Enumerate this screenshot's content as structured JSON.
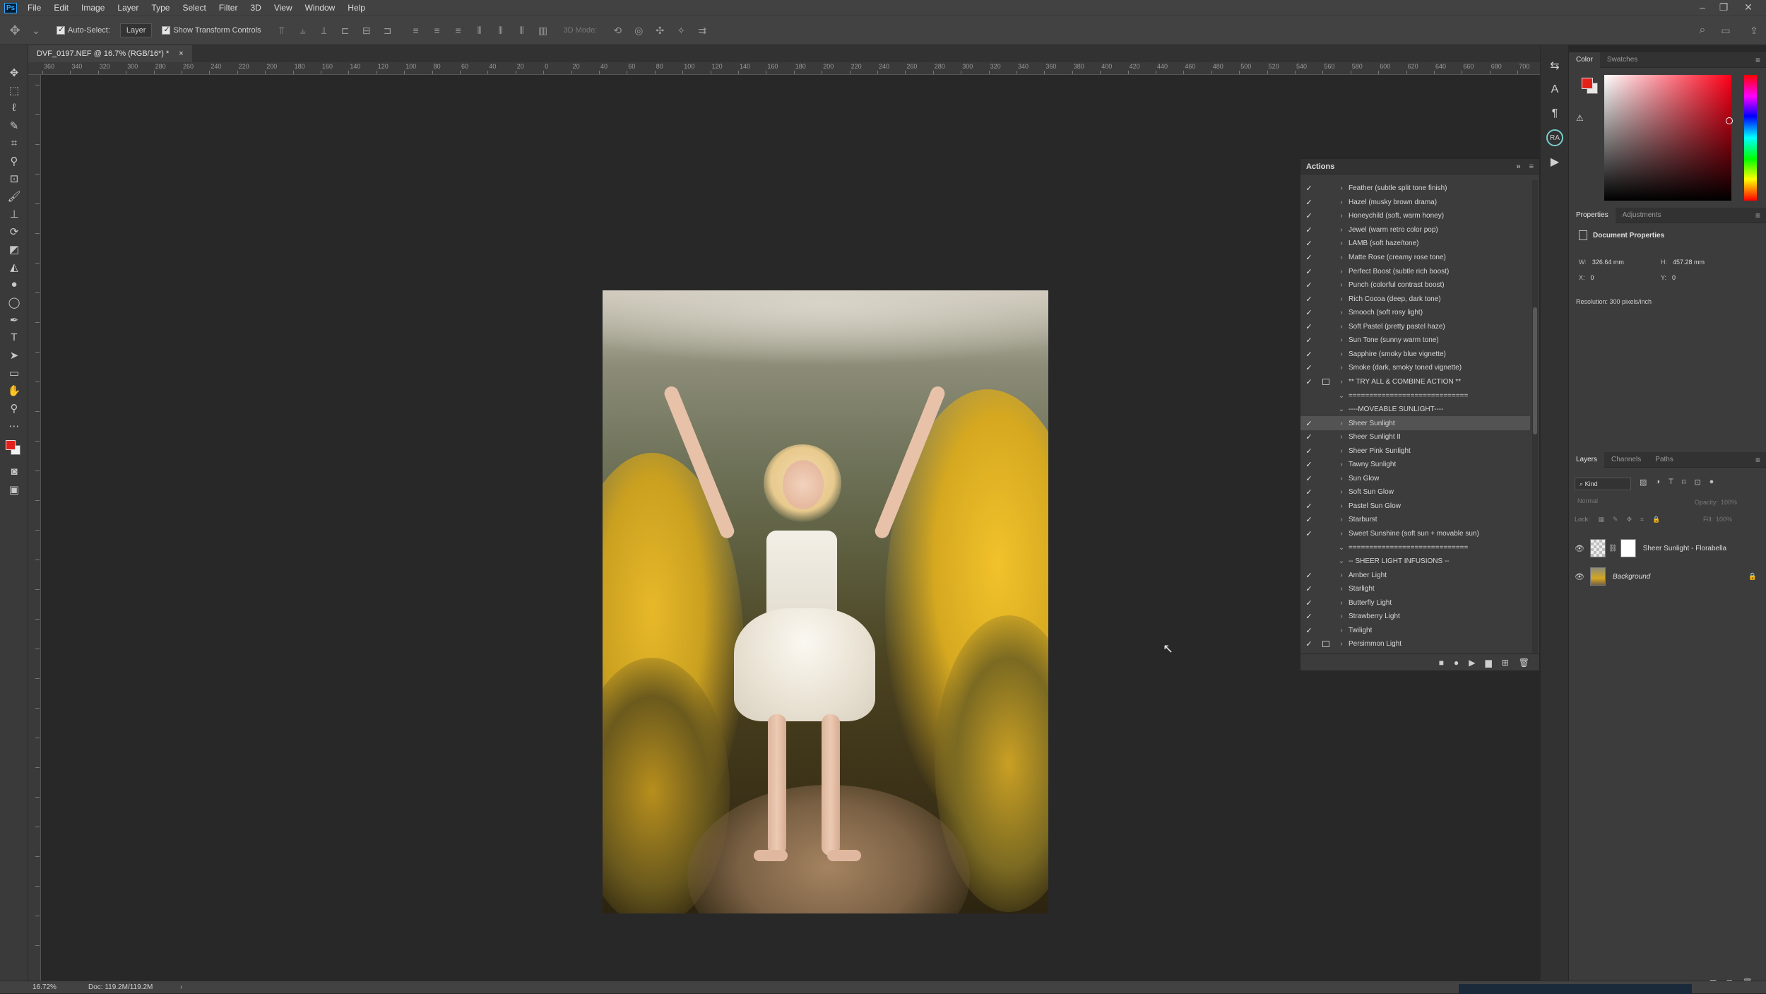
{
  "app": {
    "logo": "Ps"
  },
  "menu": [
    "File",
    "Edit",
    "Image",
    "Layer",
    "Type",
    "Select",
    "Filter",
    "3D",
    "View",
    "Window",
    "Help"
  ],
  "options": {
    "auto_select_label": "Auto-Select:",
    "auto_select_value": "Layer",
    "transform_label": "Show Transform Controls",
    "mode_3d_label": "3D Mode:"
  },
  "document_tab": {
    "title": "DVF_0197.NEF @ 16.7% (RGB/16*) *",
    "close": "×"
  },
  "ruler_labels": [
    "360",
    "340",
    "320",
    "300",
    "280",
    "260",
    "240",
    "220",
    "200",
    "180",
    "160",
    "140",
    "120",
    "100",
    "80",
    "60",
    "40",
    "20",
    "0",
    "20",
    "40",
    "60",
    "80",
    "100",
    "120",
    "140",
    "160",
    "180",
    "200",
    "220",
    "240",
    "260",
    "280",
    "300",
    "320",
    "340",
    "360",
    "380",
    "400",
    "420",
    "440",
    "460",
    "480",
    "500",
    "520",
    "540",
    "560",
    "580",
    "600",
    "620",
    "640",
    "660",
    "680",
    "700"
  ],
  "actions_panel": {
    "title": "Actions",
    "items": [
      {
        "label": "Feather (subtle split tone finish)",
        "check": "✓",
        "dialog": false,
        "expand": "›"
      },
      {
        "label": "Hazel (musky brown drama)",
        "check": "✓",
        "dialog": false,
        "expand": "›"
      },
      {
        "label": "Honeychild (soft, warm honey)",
        "check": "✓",
        "dialog": false,
        "expand": "›"
      },
      {
        "label": "Jewel (warm retro color pop)",
        "check": "✓",
        "dialog": false,
        "expand": "›"
      },
      {
        "label": "LAMB (soft haze/tone)",
        "check": "✓",
        "dialog": false,
        "expand": "›"
      },
      {
        "label": "Matte Rose (creamy rose tone)",
        "check": "✓",
        "dialog": false,
        "expand": "›"
      },
      {
        "label": "Perfect Boost (subtle rich boost)",
        "check": "✓",
        "dialog": false,
        "expand": "›"
      },
      {
        "label": "Punch (colorful contrast boost)",
        "check": "✓",
        "dialog": false,
        "expand": "›"
      },
      {
        "label": "Rich Cocoa (deep, dark tone)",
        "check": "✓",
        "dialog": false,
        "expand": "›"
      },
      {
        "label": "Smooch (soft rosy light)",
        "check": "✓",
        "dialog": false,
        "expand": "›"
      },
      {
        "label": "Soft Pastel (pretty pastel haze)",
        "check": "✓",
        "dialog": false,
        "expand": "›"
      },
      {
        "label": "Sun Tone (sunny warm tone)",
        "check": "✓",
        "dialog": false,
        "expand": "›"
      },
      {
        "label": "Sapphire (smoky blue vignette)",
        "check": "✓",
        "dialog": false,
        "expand": "›"
      },
      {
        "label": "Smoke (dark, smoky toned vignette)",
        "check": "✓",
        "dialog": false,
        "expand": "›"
      },
      {
        "label": "** TRY ALL & COMBINE ACTION **",
        "check": "✓",
        "dialog": true,
        "expand": "›"
      },
      {
        "label": "=============================",
        "check": "",
        "dialog": false,
        "expand": "⌄"
      },
      {
        "label": "----MOVEABLE SUNLIGHT----",
        "check": "",
        "dialog": false,
        "expand": "⌄"
      },
      {
        "label": "Sheer Sunlight",
        "check": "✓",
        "dialog": false,
        "expand": "›",
        "selected": true
      },
      {
        "label": "Sheer Sunlight II",
        "check": "✓",
        "dialog": false,
        "expand": "›"
      },
      {
        "label": "Sheer Pink Sunlight",
        "check": "✓",
        "dialog": false,
        "expand": "›"
      },
      {
        "label": "Tawny Sunlight",
        "check": "✓",
        "dialog": false,
        "expand": "›"
      },
      {
        "label": "Sun Glow",
        "check": "✓",
        "dialog": false,
        "expand": "›"
      },
      {
        "label": "Soft Sun Glow",
        "check": "✓",
        "dialog": false,
        "expand": "›"
      },
      {
        "label": "Pastel Sun Glow",
        "check": "✓",
        "dialog": false,
        "expand": "›"
      },
      {
        "label": "Starburst",
        "check": "✓",
        "dialog": false,
        "expand": "›"
      },
      {
        "label": "Sweet Sunshine (soft sun + movable sun)",
        "check": "✓",
        "dialog": false,
        "expand": "›"
      },
      {
        "label": "=============================",
        "check": "",
        "dialog": false,
        "expand": "⌄"
      },
      {
        "label": "-- SHEER LIGHT INFUSIONS --",
        "check": "",
        "dialog": false,
        "expand": "⌄"
      },
      {
        "label": "Amber Light",
        "check": "✓",
        "dialog": false,
        "expand": "›"
      },
      {
        "label": "Starlight",
        "check": "✓",
        "dialog": false,
        "expand": "›"
      },
      {
        "label": "Butterfly Light",
        "check": "✓",
        "dialog": false,
        "expand": "›"
      },
      {
        "label": "Strawberry Light",
        "check": "✓",
        "dialog": false,
        "expand": "›"
      },
      {
        "label": "Twilight",
        "check": "✓",
        "dialog": false,
        "expand": "›"
      },
      {
        "label": "Persimmon Light",
        "check": "✓",
        "dialog": true,
        "expand": "›"
      }
    ]
  },
  "color_panel": {
    "tabs": [
      "Color",
      "Swatches"
    ],
    "foreground": "#e3211b",
    "background": "#e8e8e8"
  },
  "properties_panel": {
    "tabs": [
      "Properties",
      "Adjustments"
    ],
    "heading": "Document Properties",
    "w_label": "W:",
    "w_value": "326.64 mm",
    "h_label": "H:",
    "h_value": "457.28 mm",
    "x_label": "X:",
    "x_value": "0",
    "y_label": "Y:",
    "y_value": "0",
    "resolution": "Resolution: 300 pixels/inch"
  },
  "layers_panel": {
    "tabs": [
      "Layers",
      "Channels",
      "Paths"
    ],
    "filter_value": "Kind",
    "blend_mode": "Normal",
    "opacity_label": "Opacity:",
    "opacity_value": "100%",
    "lock_label": "Lock:",
    "fill_label": "Fill:",
    "fill_value": "100%",
    "layers": [
      {
        "name": "Sheer Sunlight - Florabella"
      },
      {
        "name": "Background"
      }
    ]
  },
  "status": {
    "zoom": "16.72%",
    "doc": "Doc: 119.2M/119.2M"
  }
}
